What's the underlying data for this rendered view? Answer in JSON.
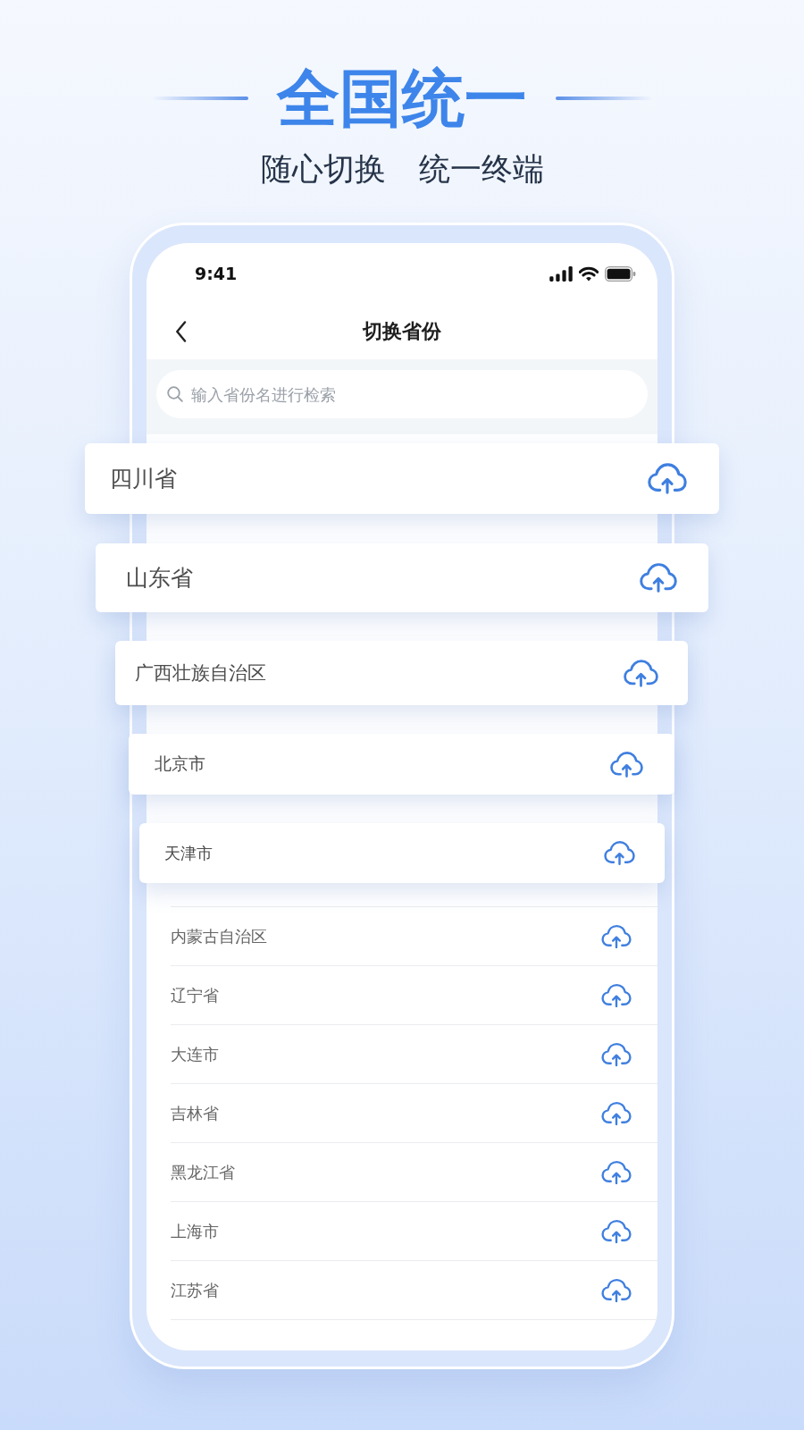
{
  "header": {
    "title": "全国统一",
    "subtitle": [
      "随心切换",
      "统一终端"
    ]
  },
  "phone": {
    "status_bar": {
      "time": "9:41"
    },
    "nav": {
      "title": "切换省份"
    },
    "search": {
      "placeholder": "输入省份名进行检索"
    },
    "featured": [
      {
        "name": "四川省"
      },
      {
        "name": "山东省"
      },
      {
        "name": "广西壮族自治区"
      },
      {
        "name": "北京市"
      },
      {
        "name": "天津市"
      }
    ],
    "provinces": [
      {
        "name": "内蒙古自治区"
      },
      {
        "name": "辽宁省"
      },
      {
        "name": "大连市"
      },
      {
        "name": "吉林省"
      },
      {
        "name": "黑龙江省"
      },
      {
        "name": "上海市"
      },
      {
        "name": "江苏省"
      }
    ]
  }
}
